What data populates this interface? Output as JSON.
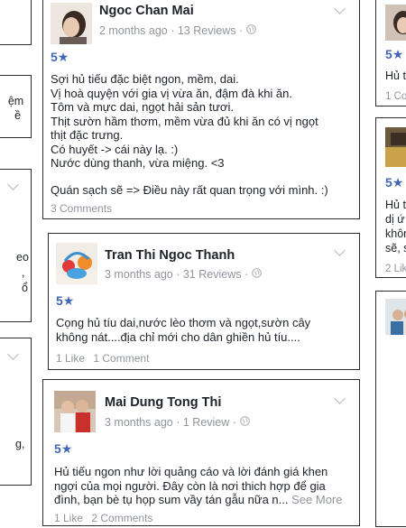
{
  "left_column": {
    "card2_lines": [
      "ệm",
      "ề"
    ],
    "card3_lines": [
      "eo",
      ",",
      "ổ"
    ],
    "card4_lines": [
      "g,"
    ]
  },
  "center_column": {
    "review1": {
      "author": "Ngoc Chan Mai",
      "time": "2 months ago",
      "reviews": "13 Reviews",
      "rating": "5★",
      "lines": [
        "Sợi hủ tiếu đặc biệt ngon, mềm, dai.",
        "Vị hoà quyện với gia vị vừa ăn, đậm đà khi ăn.",
        "Tôm và mực dai, ngọt hải sản tươi.",
        "Thịt sườn hầm thơm, mềm vừa đủ khi ăn có vị ngọt",
        "thịt đặc trưng.",
        "Có huyết -> cái này lạ. :)",
        "Nước dùng thanh, vừa miệng. <3",
        "",
        "Quán sạch sẽ => Điều này rất quan trọng với mình. :)"
      ],
      "comments": "3 Comments"
    },
    "review2": {
      "author": "Tran Thi Ngoc Thanh",
      "time": "3 months ago",
      "reviews": "31 Reviews",
      "rating": "5★",
      "lines": [
        "Cọng hủ tíu dai,nước lèo thơm và ngọt,sườn cây",
        "không nát....địa chỉ mới cho dân ghiền hủ tíu...."
      ],
      "likes": "1 Like",
      "comments": "1 Comment"
    },
    "review3": {
      "author": "Mai Dung Tong Thi",
      "time": "3 months ago",
      "reviews": "1 Review",
      "rating": "5★",
      "lines": [
        "Hủ tiếu ngon như lời quảng cáo và lời đánh giá khen",
        "ngợi của mọi người. Đây còn là nơi thich hợp để gia"
      ],
      "last_line": "đình, bạn bè tụ họp sum vầy tán gẫu nữa n...",
      "see_more": "See More",
      "likes": "1 Like",
      "comments": "2 Comments"
    }
  },
  "right_column": {
    "card1": {
      "rating": "5★",
      "text": "Hủ t",
      "foot": "1 Co"
    },
    "card2": {
      "rating": "5★",
      "lines": [
        "Hủ t",
        "dị ứ",
        "khôn",
        "sẽ, s"
      ],
      "foot": "2 Lik"
    }
  },
  "colors": {
    "accent": "#4267b2",
    "muted": "#90949c",
    "border": "#2b2b2b",
    "text": "#1d2129"
  },
  "icons": {
    "menu": "chevron-down-icon",
    "privacy": "globe-icon"
  }
}
